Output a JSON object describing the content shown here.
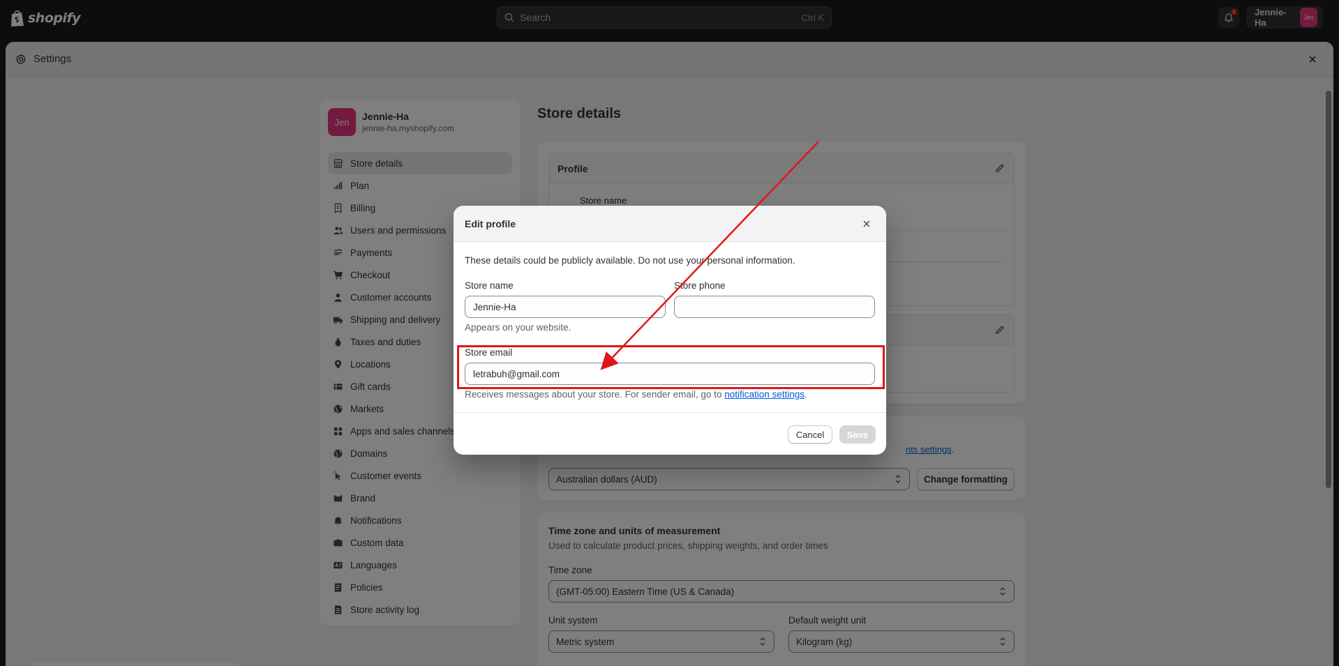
{
  "topbar": {
    "logo_text": "shopify",
    "search_placeholder": "Search",
    "search_shortcut": "Ctrl K",
    "notification_count": "2",
    "user_name": "Jennie-Ha",
    "user_avatar": "Jen"
  },
  "window": {
    "title": "Settings"
  },
  "sidebar": {
    "store_avatar": "Jen",
    "store_name": "Jennie-Ha",
    "store_url": "jennie-ha.myshopify.com",
    "items": [
      {
        "label": "Store details",
        "icon": "store-icon",
        "active": true
      },
      {
        "label": "Plan",
        "icon": "chart-icon"
      },
      {
        "label": "Billing",
        "icon": "receipt-icon"
      },
      {
        "label": "Users and permissions",
        "icon": "users-icon"
      },
      {
        "label": "Payments",
        "icon": "payments-icon"
      },
      {
        "label": "Checkout",
        "icon": "cart-icon"
      },
      {
        "label": "Customer accounts",
        "icon": "person-icon"
      },
      {
        "label": "Shipping and delivery",
        "icon": "truck-icon"
      },
      {
        "label": "Taxes and duties",
        "icon": "money-bag-icon"
      },
      {
        "label": "Locations",
        "icon": "location-icon"
      },
      {
        "label": "Gift cards",
        "icon": "gift-card-icon"
      },
      {
        "label": "Markets",
        "icon": "globe-icon"
      },
      {
        "label": "Apps and sales channels",
        "icon": "apps-icon"
      },
      {
        "label": "Domains",
        "icon": "globe-icon"
      },
      {
        "label": "Customer events",
        "icon": "cursor-icon"
      },
      {
        "label": "Brand",
        "icon": "brand-icon"
      },
      {
        "label": "Notifications",
        "icon": "bell-icon"
      },
      {
        "label": "Custom data",
        "icon": "database-icon"
      },
      {
        "label": "Languages",
        "icon": "language-icon"
      },
      {
        "label": "Policies",
        "icon": "policy-icon"
      },
      {
        "label": "Store activity log",
        "icon": "log-icon"
      }
    ]
  },
  "main": {
    "title": "Store details",
    "profile_header": "Profile",
    "store_name_label": "Store name",
    "currency_hint_suffix": "nts settings",
    "currency_value": "Australian dollars (AUD)",
    "change_formatting": "Change formatting",
    "tz_title": "Time zone and units of measurement",
    "tz_sub": "Used to calculate product prices, shipping weights, and order times",
    "time_zone_label": "Time zone",
    "time_zone_value": "(GMT-05:00) Eastern Time (US & Canada)",
    "unit_system_label": "Unit system",
    "unit_system_value": "Metric system",
    "weight_unit_label": "Default weight unit",
    "weight_unit_value": "Kilogram (kg)"
  },
  "modal": {
    "title": "Edit profile",
    "notice": "These details could be publicly available. Do not use your personal information.",
    "store_name_label": "Store name",
    "store_name_value": "Jennie-Ha",
    "store_name_help": "Appears on your website.",
    "store_phone_label": "Store phone",
    "store_phone_value": "",
    "store_email_label": "Store email",
    "store_email_value": "letrabuh@gmail.com",
    "email_help_prefix": "Receives messages about your store. For sender email, go to ",
    "email_help_link": "notification settings",
    "email_help_suffix": ".",
    "cancel_label": "Cancel",
    "save_label": "Save"
  },
  "colors": {
    "accent_red": "#e0161b",
    "avatar_pink": "#e5367f",
    "link_blue": "#005bd3"
  }
}
